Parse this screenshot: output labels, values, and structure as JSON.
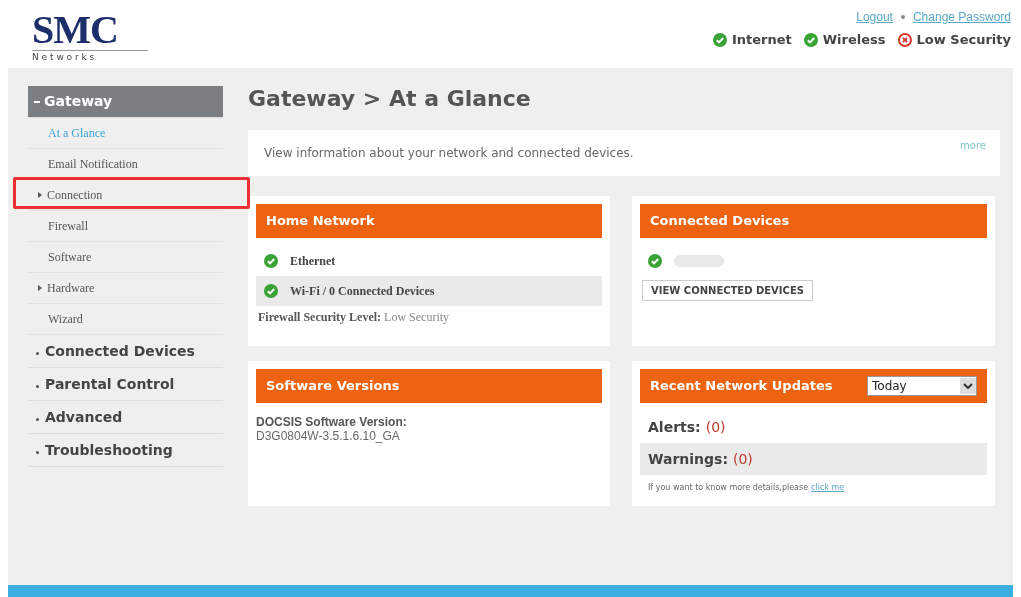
{
  "logo": {
    "brand": "SMC",
    "tagline": "N e t w o r k s"
  },
  "header_links": [
    "Logout",
    "Change Password"
  ],
  "status": [
    {
      "label": "Internet",
      "ok": true
    },
    {
      "label": "Wireless",
      "ok": true
    },
    {
      "label": "Low Security",
      "ok": false
    }
  ],
  "sidebar": {
    "items": [
      {
        "label": "Gateway",
        "expanded": true,
        "children": [
          {
            "label": "At a Glance",
            "selected": true,
            "has_submenu": false,
            "highlighted": false
          },
          {
            "label": "Email Notification",
            "selected": false,
            "has_submenu": false,
            "highlighted": false
          },
          {
            "label": "Connection",
            "selected": false,
            "has_submenu": true,
            "highlighted": true
          },
          {
            "label": "Firewall",
            "selected": false,
            "has_submenu": false,
            "highlighted": false
          },
          {
            "label": "Software",
            "selected": false,
            "has_submenu": false,
            "highlighted": false
          },
          {
            "label": "Hardware",
            "selected": false,
            "has_submenu": true,
            "highlighted": false
          },
          {
            "label": "Wizard",
            "selected": false,
            "has_submenu": false,
            "highlighted": false
          }
        ]
      },
      {
        "label": "Connected Devices",
        "expanded": false
      },
      {
        "label": "Parental Control",
        "expanded": false
      },
      {
        "label": "Advanced",
        "expanded": false
      },
      {
        "label": "Troubleshooting",
        "expanded": false
      }
    ]
  },
  "page_title": "Gateway > At a Glance",
  "intro": {
    "text": "View information about your network and connected devices.",
    "link": "more"
  },
  "home_network": {
    "title": "Home Network",
    "rows": [
      {
        "label": "Ethernet",
        "ok": true,
        "shaded": false
      },
      {
        "label": "Wi-Fi / 0 Connected Devices",
        "ok": true,
        "shaded": true
      }
    ],
    "firewall_label": "Firewall Security Level:",
    "firewall_value": "Low Security"
  },
  "connected_devices": {
    "title": "Connected Devices",
    "devices": [
      {
        "ok": true
      }
    ],
    "button": "VIEW CONNECTED DEVICES"
  },
  "software_versions": {
    "title": "Software Versions",
    "label": "DOCSIS Software Version:",
    "value": "D3G0804W-3.5.1.6.10_GA"
  },
  "recent_updates": {
    "title": "Recent Network Updates",
    "period": "Today",
    "rows": [
      {
        "label": "Alerts:",
        "count": "(0)",
        "shaded": false
      },
      {
        "label": "Warnings:",
        "count": "(0)",
        "shaded": true
      }
    ],
    "note": "If you want to know more details,please",
    "note_link": "click me"
  }
}
